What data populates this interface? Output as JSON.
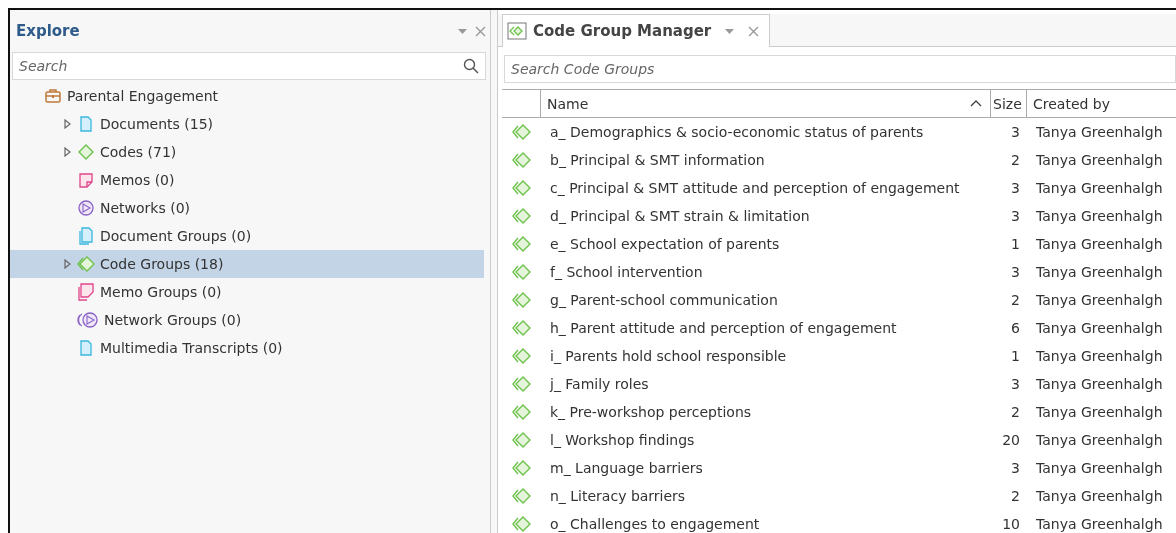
{
  "explore": {
    "title": "Explore",
    "search": {
      "placeholder": "Search"
    },
    "tree": [
      {
        "label": "Parental Engagement",
        "kind": "project",
        "selected": false,
        "children": [
          {
            "label": "Documents (15)",
            "kind": "document",
            "collapsed": true,
            "selected": false
          },
          {
            "label": "Codes (71)",
            "kind": "code",
            "collapsed": true,
            "selected": false
          },
          {
            "label": "Memos (0)",
            "kind": "memo",
            "collapsed": false,
            "selected": false
          },
          {
            "label": "Networks (0)",
            "kind": "network",
            "collapsed": false,
            "selected": false
          },
          {
            "label": "Document Groups (0)",
            "kind": "document-group",
            "collapsed": false,
            "selected": false
          },
          {
            "label": "Code Groups (18)",
            "kind": "code-group",
            "collapsed": true,
            "selected": true
          },
          {
            "label": "Memo Groups (0)",
            "kind": "memo-group",
            "collapsed": false,
            "selected": false
          },
          {
            "label": "Network Groups (0)",
            "kind": "network-group",
            "collapsed": false,
            "selected": false
          },
          {
            "label": "Multimedia Transcripts (0)",
            "kind": "transcript",
            "collapsed": false,
            "selected": false
          }
        ]
      }
    ]
  },
  "manager": {
    "tab": {
      "title": "Code Group Manager"
    },
    "search": {
      "placeholder": "Search Code Groups"
    },
    "table": {
      "columns": [
        "Name",
        "Size",
        "Created by"
      ],
      "rows": [
        [
          "a_ Demographics & socio-economic status of parents",
          "3",
          "Tanya Greenhalgh"
        ],
        [
          "b_ Principal & SMT information",
          "2",
          "Tanya Greenhalgh"
        ],
        [
          "c_ Principal & SMT attitude and perception of engagement",
          "3",
          "Tanya Greenhalgh"
        ],
        [
          "d_ Principal & SMT strain & limitation",
          "3",
          "Tanya Greenhalgh"
        ],
        [
          "e_ School expectation of parents",
          "1",
          "Tanya Greenhalgh"
        ],
        [
          "f_ School intervention",
          "3",
          "Tanya Greenhalgh"
        ],
        [
          "g_ Parent-school communication",
          "2",
          "Tanya Greenhalgh"
        ],
        [
          "h_ Parent attitude and perception of engagement",
          "6",
          "Tanya Greenhalgh"
        ],
        [
          "i_ Parents hold school responsible",
          "1",
          "Tanya Greenhalgh"
        ],
        [
          "j_ Family roles",
          "3",
          "Tanya Greenhalgh"
        ],
        [
          "k_ Pre-workshop perceptions",
          "2",
          "Tanya Greenhalgh"
        ],
        [
          "l_ Workshop findings",
          "20",
          "Tanya Greenhalgh"
        ],
        [
          "m_ Language barriers",
          "3",
          "Tanya Greenhalgh"
        ],
        [
          "n_ Literacy barriers",
          "2",
          "Tanya Greenhalgh"
        ],
        [
          "o_ Challenges to engagement",
          "10",
          "Tanya Greenhalgh"
        ]
      ]
    }
  }
}
